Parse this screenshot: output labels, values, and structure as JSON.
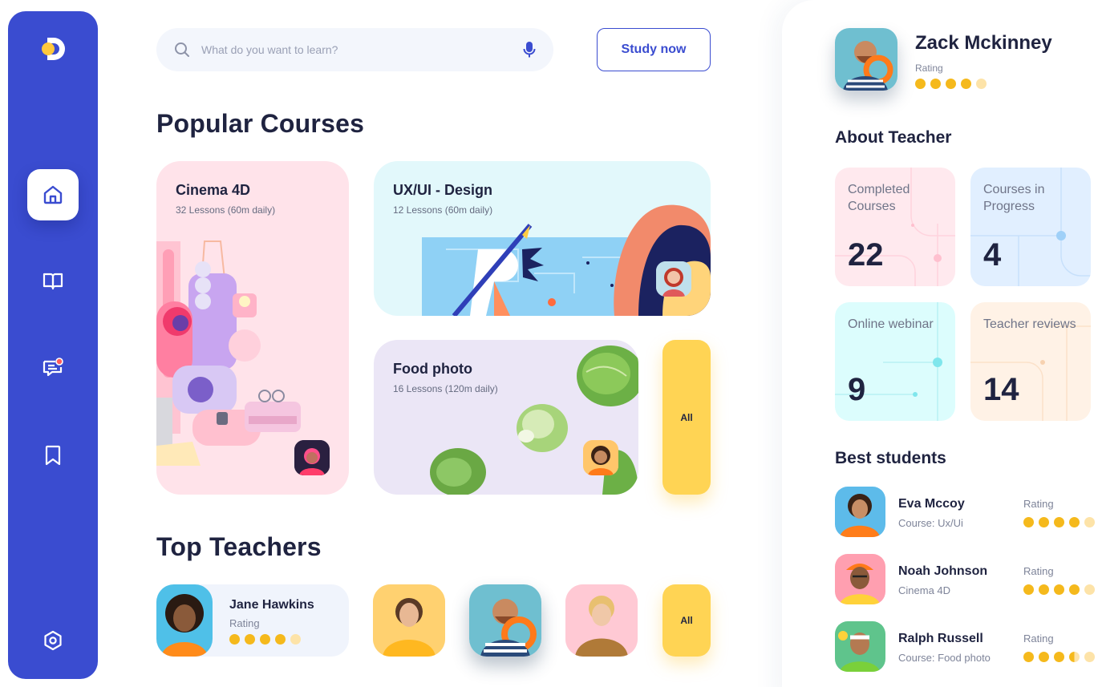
{
  "search": {
    "placeholder": "What do you want to learn?"
  },
  "header": {
    "study_now_label": "Study now"
  },
  "sections": {
    "popular_courses": "Popular Courses",
    "top_teachers": "Top Teachers"
  },
  "courses": [
    {
      "title": "Cinema 4D",
      "subtitle": "32 Lessons (60m daily)"
    },
    {
      "title": "UX/UI - Design",
      "subtitle": "12 Lessons (60m daily)"
    },
    {
      "title": "Food photo",
      "subtitle": "16 Lessons (120m daily)"
    }
  ],
  "all_label": "All",
  "featured_teacher": {
    "name": "Jane Hawkins",
    "rating_label": "Rating",
    "rating": 4
  },
  "profile": {
    "name": "Zack Mckinney",
    "rating_label": "Rating",
    "rating": 4
  },
  "about_teacher": {
    "title": "About Teacher",
    "stats": [
      {
        "label": "Completed Courses",
        "value": "22"
      },
      {
        "label": "Courses in Progress",
        "value": "4"
      },
      {
        "label": "Online webinar",
        "value": "9"
      },
      {
        "label": "Teacher reviews",
        "value": "14"
      }
    ]
  },
  "best_students": {
    "title": "Best students",
    "rating_label": "Rating",
    "items": [
      {
        "name": "Eva Mccoy",
        "course": "Course: Ux/Ui",
        "rating": 4
      },
      {
        "name": "Noah Johnson",
        "course": "Cinema 4D",
        "rating": 4
      },
      {
        "name": "Ralph Russell",
        "course": "Course: Food photo",
        "rating": 3.5
      }
    ]
  },
  "colors": {
    "sidebar": "#3a4cd0",
    "accent_yellow": "#ffd454",
    "star": "#f5b91c",
    "cinema_card": "#ffe3ea",
    "uxui_card": "#e2f8fb",
    "food_card": "#ebe6f6",
    "stat_completed": "#ffe9ee",
    "stat_progress": "#e1efff",
    "stat_webinar": "#dcfdfd",
    "stat_reviews": "#fff2e6"
  },
  "icons": [
    "logo-icon",
    "home-icon",
    "book-icon",
    "chat-notification-icon",
    "bookmark-icon",
    "settings-icon",
    "search-icon",
    "microphone-icon"
  ]
}
